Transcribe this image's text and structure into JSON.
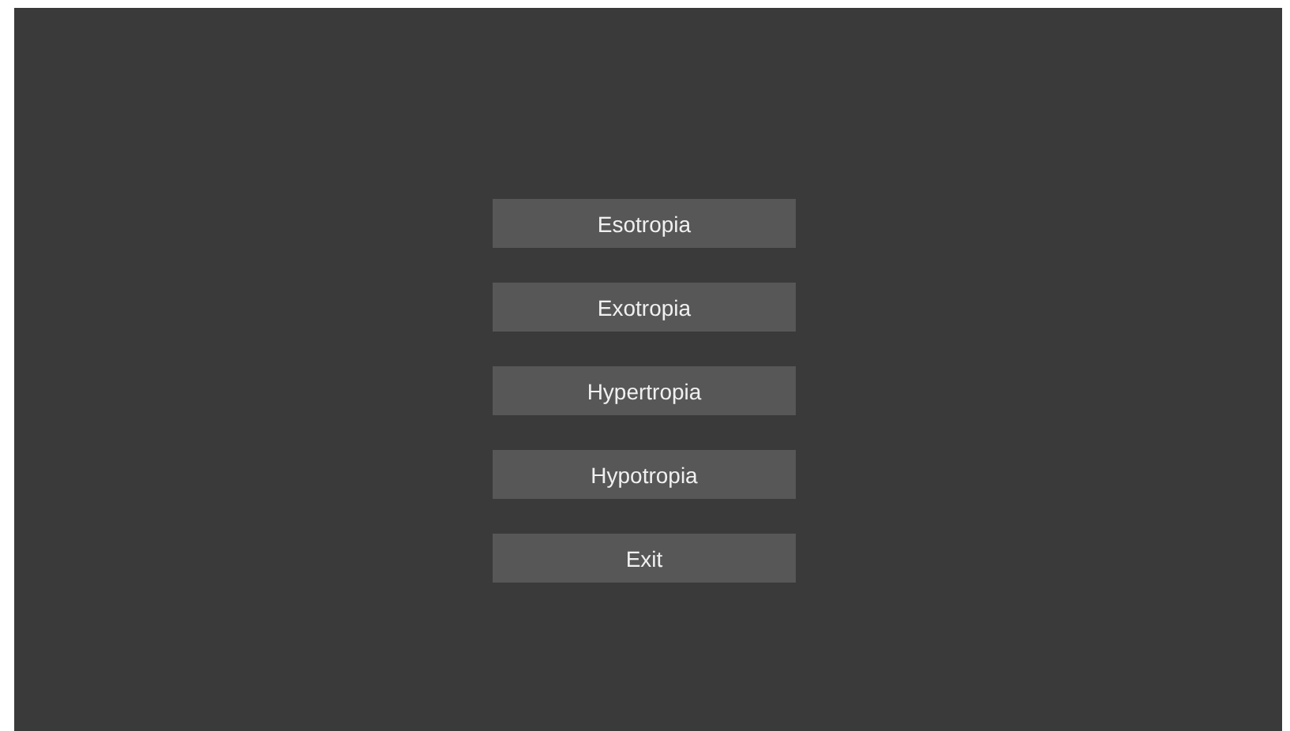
{
  "menu": {
    "buttons": [
      {
        "label": "Esotropia"
      },
      {
        "label": "Exotropia"
      },
      {
        "label": "Hypertropia"
      },
      {
        "label": "Hypotropia"
      },
      {
        "label": "Exit"
      }
    ]
  }
}
